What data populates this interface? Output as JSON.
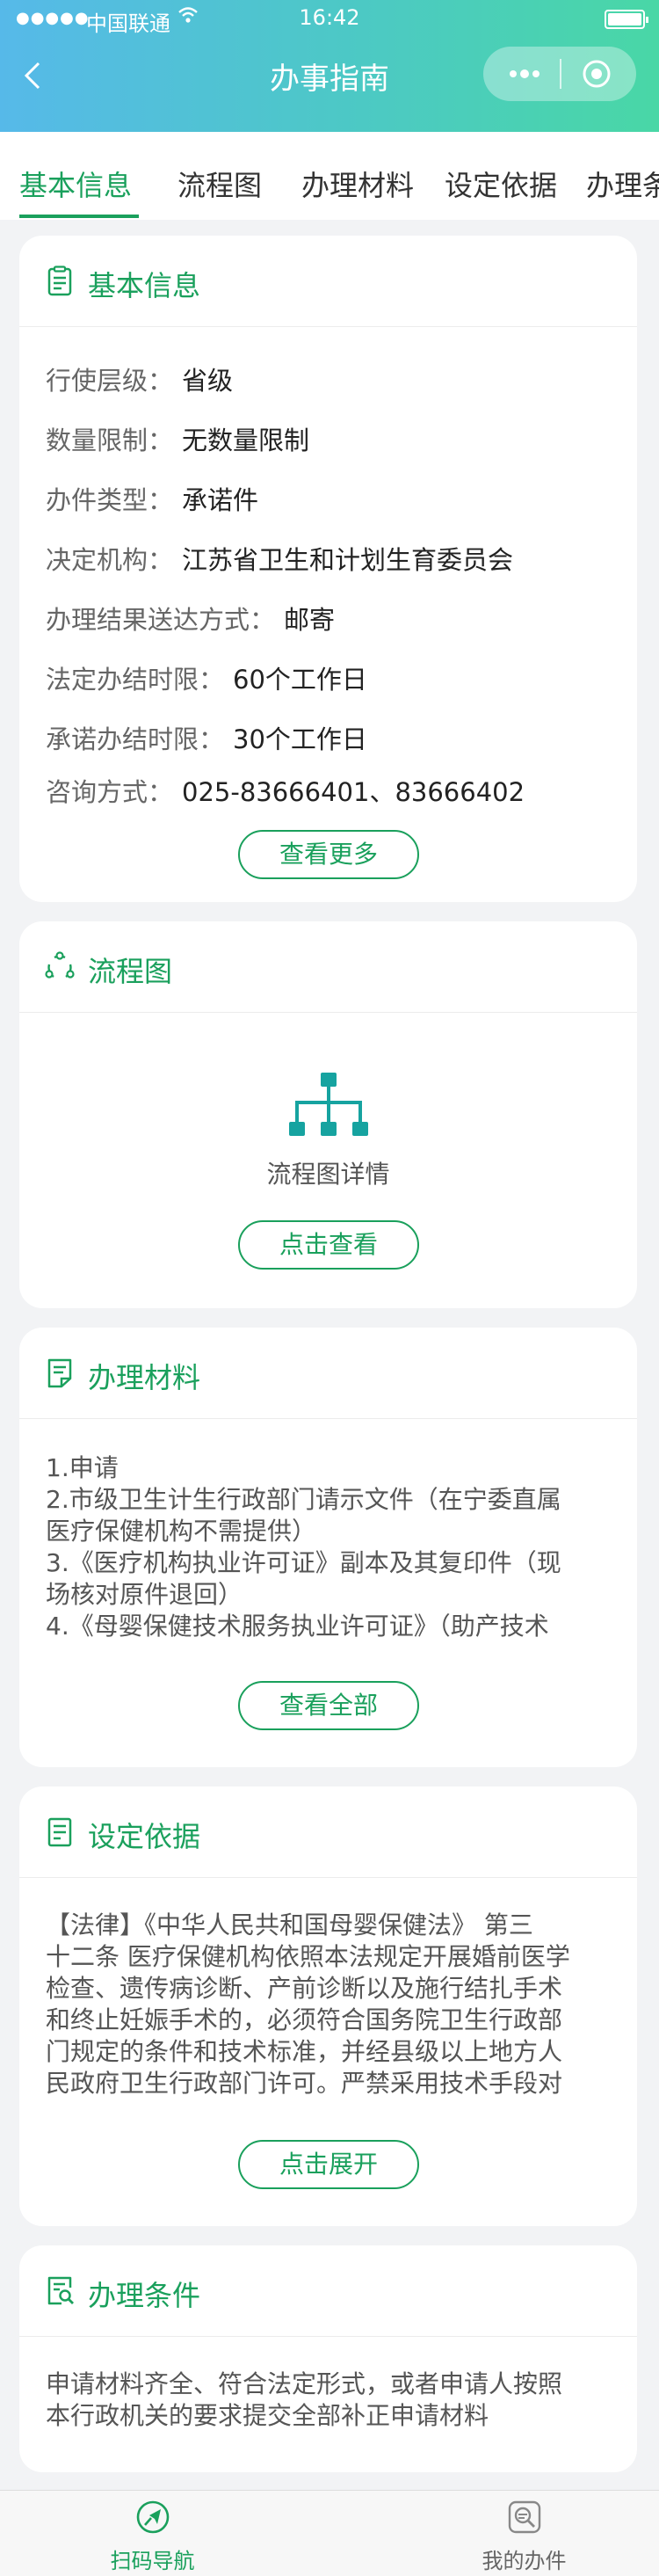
{
  "status_bar": {
    "signal": "●●●●●",
    "carrier": "中国联通",
    "time": "16:42"
  },
  "header": {
    "title": "办事指南"
  },
  "tabs": [
    {
      "label": "基本信息",
      "active": true
    },
    {
      "label": "流程图"
    },
    {
      "label": "办理材料"
    },
    {
      "label": "设定依据"
    },
    {
      "label": "办理条件"
    }
  ],
  "basic_info": {
    "title": "基本信息",
    "rows": [
      {
        "label": "行使层级：",
        "value": "省级"
      },
      {
        "label": "数量限制：",
        "value": "无数量限制"
      },
      {
        "label": "办件类型：",
        "value": "承诺件"
      },
      {
        "label": "决定机构：",
        "value": "江苏省卫生和计划生育委员会"
      },
      {
        "label": "办理结果送达方式：",
        "value": "邮寄"
      },
      {
        "label": "法定办结时限：",
        "value": "60个工作日"
      },
      {
        "label": "承诺办结时限：",
        "value": "30个工作日"
      },
      {
        "label": "咨询方式：",
        "value": "025-83666401、83666402"
      }
    ],
    "button": "查看更多"
  },
  "flowchart": {
    "title": "流程图",
    "caption": "流程图详情",
    "button": "点击查看"
  },
  "materials": {
    "title": "办理材料",
    "lines": [
      "1.申请",
      "2.市级卫生计生行政部门请示文件（在宁委直属",
      "医疗保健机构不需提供）",
      "3.《医疗机构执业许可证》副本及其复印件（现",
      "场核对原件退回）",
      "4.《母婴保健技术服务执业许可证》（助产技术"
    ],
    "button": "查看全部"
  },
  "basis": {
    "title": "设定依据",
    "lines": [
      "【法律】《中华人民共和国母婴保健法》 第三",
      "十二条 医疗保健机构依照本法规定开展婚前医学",
      "检查、遗传病诊断、产前诊断以及施行结扎手术",
      "和终止妊娠手术的，必须符合国务院卫生行政部",
      "门规定的条件和技术标准，并经县级以上地方人",
      "民政府卫生行政部门许可。严禁采用技术手段对"
    ],
    "button": "点击展开"
  },
  "conditions": {
    "title": "办理条件",
    "lines": [
      "申请材料齐全、符合法定形式，或者申请人按照",
      "本行政机关的要求提交全部补正申请材料"
    ]
  },
  "tabbar": [
    {
      "label": "扫码导航",
      "icon": "navigation-icon",
      "active": true
    },
    {
      "label": "我的办件",
      "icon": "my-cases-icon"
    }
  ],
  "colors": {
    "accent": "#1aa05c",
    "header_gradient": [
      "#56b9e9",
      "#49d7a6"
    ],
    "flow_icon": "#16a3a0"
  }
}
